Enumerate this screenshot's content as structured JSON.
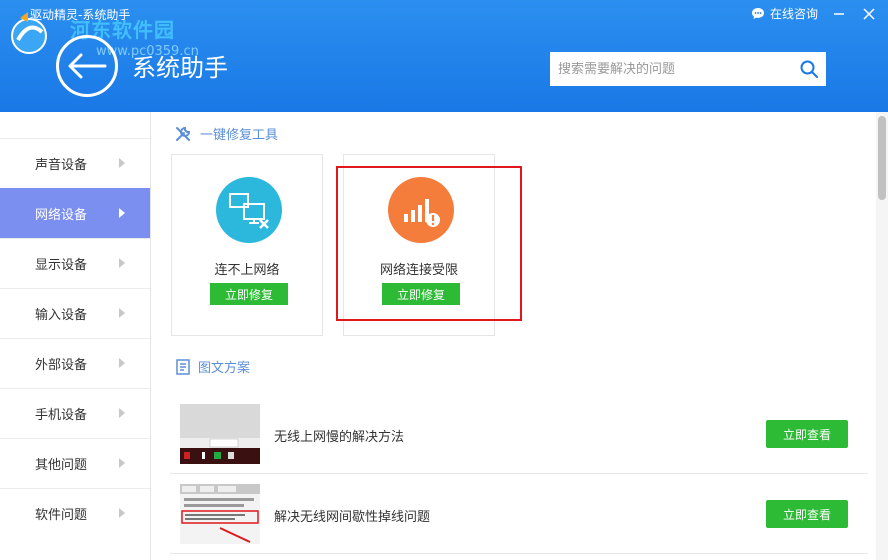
{
  "window": {
    "title": "驱动精灵-系统助手",
    "watermark": "河东软件园",
    "watermark_url": "www.pc0359.cn",
    "consult_label": "在线咨询"
  },
  "header": {
    "page_title": "系统助手",
    "search_placeholder": "搜索需要解决的问题"
  },
  "sidebar": {
    "items": [
      {
        "label": "声音设备",
        "active": false
      },
      {
        "label": "网络设备",
        "active": true
      },
      {
        "label": "显示设备",
        "active": false
      },
      {
        "label": "输入设备",
        "active": false
      },
      {
        "label": "外部设备",
        "active": false
      },
      {
        "label": "手机设备",
        "active": false
      },
      {
        "label": "其他问题",
        "active": false
      },
      {
        "label": "软件问题",
        "active": false
      }
    ]
  },
  "tools": {
    "section_title": "一键修复工具",
    "cards": [
      {
        "label": "连不上网络",
        "button": "立即修复",
        "icon": "network-disconnected-icon",
        "color": "#2bb8dc"
      },
      {
        "label": "网络连接受限",
        "button": "立即修复",
        "icon": "signal-warning-icon",
        "color": "#f47d3c"
      }
    ]
  },
  "articles": {
    "section_title": "图文方案",
    "items": [
      {
        "title": "无线上网慢的解决方法",
        "button": "立即查看"
      },
      {
        "title": "解决无线网间歇性掉线问题",
        "button": "立即查看"
      }
    ]
  },
  "colors": {
    "header_blue": "#1a78e6",
    "sidebar_active": "#7b8ff0",
    "button_green": "#2dbb36",
    "highlight_red": "#e0171c"
  }
}
